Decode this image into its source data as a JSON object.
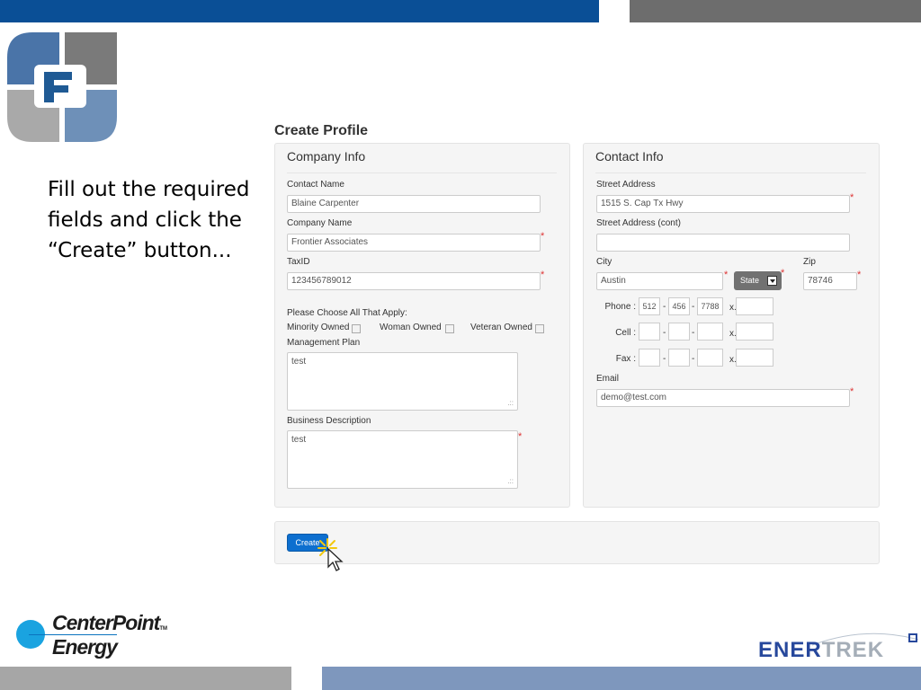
{
  "slide": {
    "instruction": "Fill out the required fields and click the “Create” button...",
    "colors": {
      "brand_blue": "#0a4f96",
      "brand_gray": "#6d6d6d",
      "button_blue": "#0d6fcf",
      "required_red": "#dd3333"
    }
  },
  "form": {
    "title": "Create Profile",
    "required_mark": "*",
    "company": {
      "heading": "Company Info",
      "contact_name": {
        "label": "Contact Name",
        "value": "Blaine Carpenter"
      },
      "company_name": {
        "label": "Company Name",
        "value": "Frontier Associates"
      },
      "tax_id": {
        "label": "TaxID",
        "value": "123456789012"
      },
      "choose_label": "Please Choose All That Apply:",
      "checkboxes": [
        {
          "label": "Minority Owned",
          "checked": false
        },
        {
          "label": "Woman Owned",
          "checked": false
        },
        {
          "label": "Veteran Owned",
          "checked": false
        }
      ],
      "management_plan": {
        "label": "Management Plan",
        "value": "test"
      },
      "business_description": {
        "label": "Business Description",
        "value": "test"
      }
    },
    "contact": {
      "heading": "Contact Info",
      "street": {
        "label": "Street Address",
        "value": "1515 S. Cap Tx Hwy"
      },
      "street2": {
        "label": "Street Address (cont)",
        "value": ""
      },
      "city": {
        "label": "City",
        "value": "Austin"
      },
      "state": {
        "label": "State"
      },
      "zip": {
        "label": "Zip",
        "value": "78746"
      },
      "phone": {
        "label": "Phone :",
        "area": "512",
        "prefix": "456",
        "line": "7788",
        "ext_label": "x.",
        "ext": ""
      },
      "cell": {
        "label": "Cell :",
        "area": "",
        "prefix": "",
        "line": "",
        "ext_label": "x.",
        "ext": ""
      },
      "fax": {
        "label": "Fax :",
        "area": "",
        "prefix": "",
        "line": "",
        "ext_label": "x.",
        "ext": ""
      },
      "dash": "-",
      "email": {
        "label": "Email",
        "value": "demo@test.com"
      }
    },
    "create_button": "Create"
  },
  "footer": {
    "centerpoint_line1": "CenterPoint",
    "centerpoint_line2": "Energy",
    "centerpoint_tm": "TM",
    "enertrek_part1": "ENER",
    "enertrek_part2": "TREK"
  }
}
